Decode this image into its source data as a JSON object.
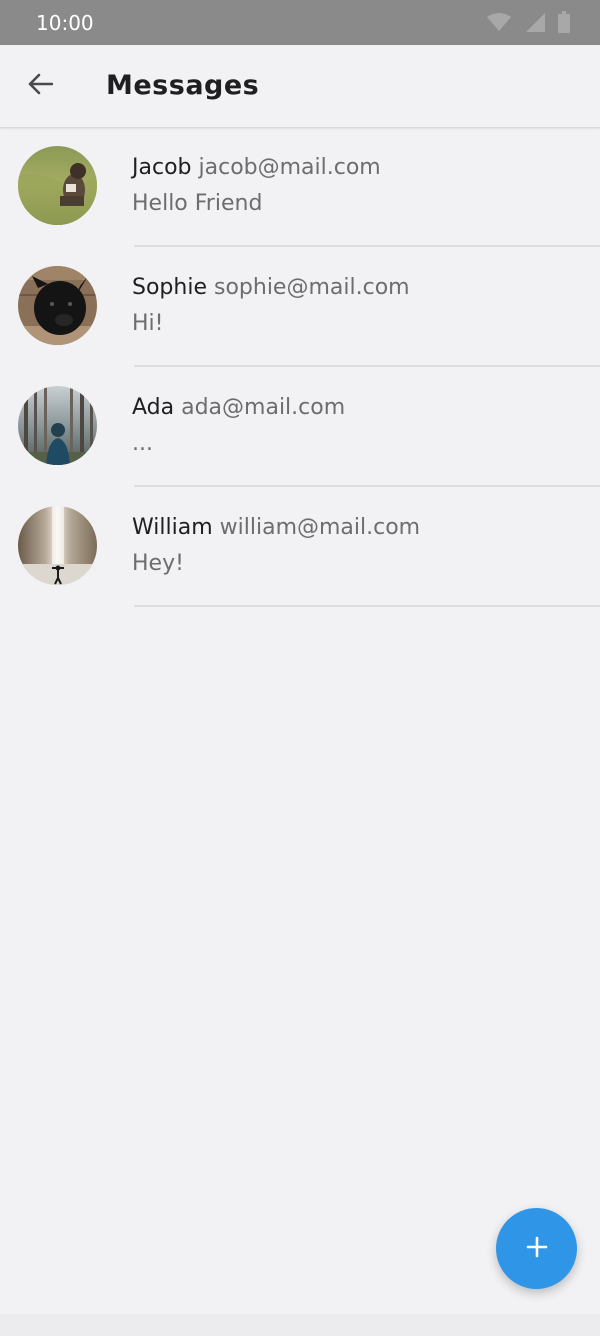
{
  "status_bar": {
    "time": "10:00",
    "icons": [
      "wifi-icon",
      "signal-icon",
      "battery-icon"
    ],
    "background": "#8b8a8b"
  },
  "app_bar": {
    "back_icon": "arrow-back-icon",
    "title": "Messages"
  },
  "messages": [
    {
      "name": "Jacob",
      "email": "jacob@mail.com",
      "text": "Hello Friend",
      "avatar": "photo-person-in-grass"
    },
    {
      "name": "Sophie",
      "email": "sophie@mail.com",
      "text": "Hi!",
      "avatar": "photo-black-dog"
    },
    {
      "name": "Ada",
      "email": "ada@mail.com",
      "text": "...",
      "avatar": "photo-person-in-forest"
    },
    {
      "name": "William",
      "email": "william@mail.com",
      "text": "Hey!",
      "avatar": "photo-person-at-waterfall"
    }
  ],
  "fab": {
    "icon": "plus-icon",
    "color": "#2f95e6"
  },
  "colors": {
    "background": "#f2f1f3",
    "primary_text": "#1f1f21",
    "secondary_text": "#6d6d70",
    "divider": "#dcdbde"
  }
}
